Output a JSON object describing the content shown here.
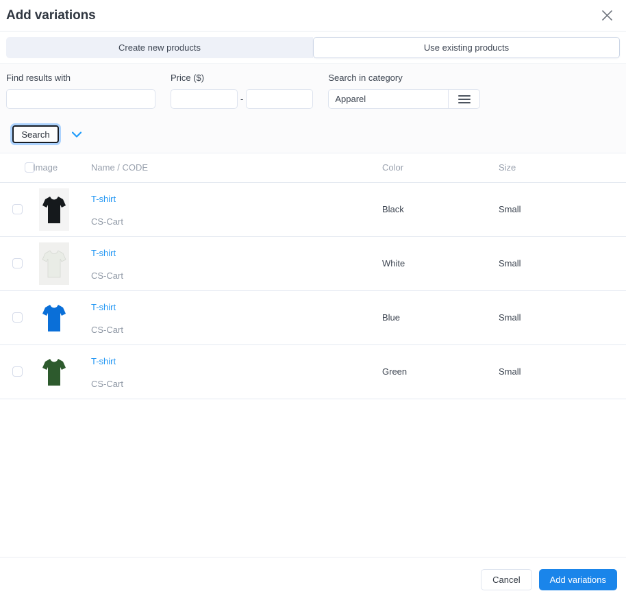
{
  "modal": {
    "title": "Add variations",
    "close_icon": "close-icon"
  },
  "tabs": [
    {
      "label": "Create new products",
      "active": false
    },
    {
      "label": "Use existing products",
      "active": true
    }
  ],
  "search": {
    "find_label": "Find results with",
    "find_value": "",
    "price_label": "Price ($)",
    "price_from": "",
    "price_to": "",
    "price_separator": "-",
    "category_label": "Search in category",
    "category_value": "Apparel",
    "category_icon": "list-bars-icon",
    "search_button": "Search",
    "expand_icon": "chevron-down-icon"
  },
  "table": {
    "columns": [
      "Image",
      "Name / CODE",
      "Color",
      "Size"
    ],
    "select_all_checkbox": "select-all-checkbox",
    "rows": [
      {
        "name": "T-shirt",
        "code": "CS-Cart",
        "color": "Black",
        "size": "Small",
        "swatch": "#15191c",
        "bg": "#f4f4f4"
      },
      {
        "name": "T-shirt",
        "code": "CS-Cart",
        "color": "White",
        "size": "Small",
        "swatch": "#e9ece6",
        "bg": "#f0f0ee"
      },
      {
        "name": "T-shirt",
        "code": "CS-Cart",
        "color": "Blue",
        "size": "Small",
        "swatch": "#0a6fd8",
        "bg": "#ffffff"
      },
      {
        "name": "T-shirt",
        "code": "CS-Cart",
        "color": "Green",
        "size": "Small",
        "swatch": "#2d5a2d",
        "bg": "#ffffff"
      }
    ]
  },
  "footer": {
    "cancel_label": "Cancel",
    "submit_label": "Add variations"
  },
  "colors": {
    "accent": "#1a85ea",
    "link": "#2196f3",
    "tab_inactive_bg": "#eef1f8",
    "border": "#e4e9f1"
  }
}
